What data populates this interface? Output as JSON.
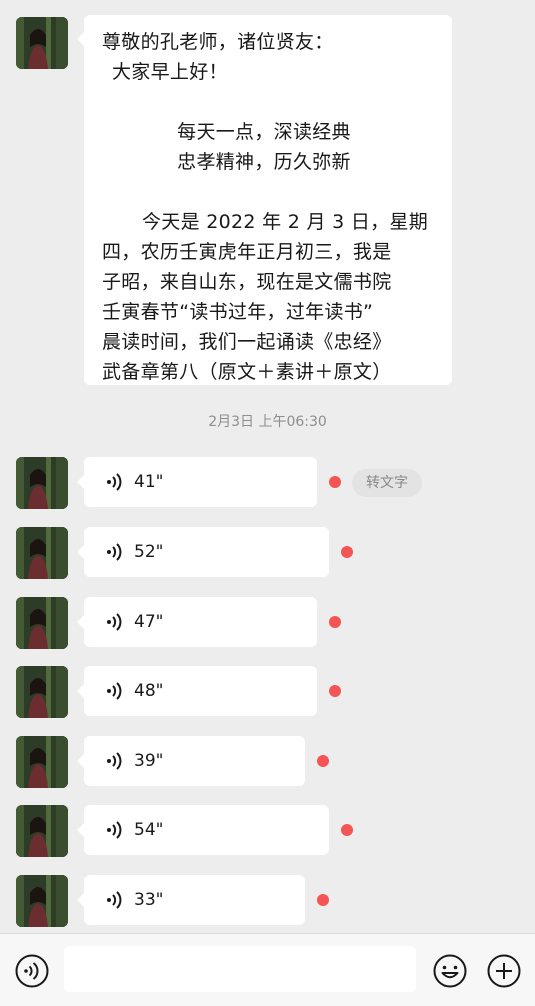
{
  "message": {
    "lines": [
      "尊敬的孔老师，诸位贤友：",
      "大家早上好！",
      "每天一点，深读经典",
      "忠孝精神，历久弥新",
      "今天是 2022 年 2 月 3 日，星期",
      "四，农历壬寅虎年正月初三，我是",
      "子昭，来自山东，现在是文儒书院",
      "壬寅春节“读书过年，过年读书”",
      "晨读时间，我们一起诵读《忠经》",
      "武备章第八（原文＋素讲＋原文）"
    ]
  },
  "timestamp": "2月3日 上午06:30",
  "voice_messages": [
    {
      "duration": "41\""
    },
    {
      "duration": "52\""
    },
    {
      "duration": "47\""
    },
    {
      "duration": "48\""
    },
    {
      "duration": "39\""
    },
    {
      "duration": "54\""
    },
    {
      "duration": "33\""
    }
  ],
  "convert_to_text_label": "转文字",
  "icons": {
    "voice": "voice-wave-icon",
    "emoji": "emoji-icon",
    "more": "plus-icon"
  },
  "colors": {
    "background": "#ededed",
    "bubble": "#ffffff",
    "unread_dot": "#f45454"
  }
}
